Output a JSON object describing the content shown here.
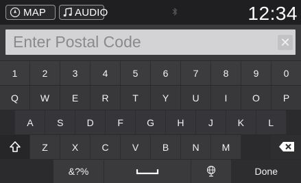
{
  "statusbar": {
    "map_label": "MAP",
    "audio_label": "AUDIO",
    "clock": "12:34",
    "icons": {
      "map": "compass-icon",
      "audio": "music-note-icon",
      "bluetooth": "bluetooth-icon"
    }
  },
  "input": {
    "placeholder": "Enter Postal Code",
    "value": "",
    "clear_glyph": "✕"
  },
  "keyboard": {
    "row1": [
      "1",
      "2",
      "3",
      "4",
      "5",
      "6",
      "7",
      "8",
      "9",
      "0"
    ],
    "row2": [
      "Q",
      "W",
      "E",
      "R",
      "T",
      "Y",
      "U",
      "I",
      "O",
      "P"
    ],
    "row3": [
      "A",
      "S",
      "D",
      "F",
      "G",
      "H",
      "J",
      "K",
      "L"
    ],
    "row4": [
      "Z",
      "X",
      "C",
      "V",
      "B",
      "N",
      "M"
    ],
    "symbols_label": "&?%",
    "done_label": "Done",
    "icons": {
      "shift": "shift-icon",
      "backspace": "backspace-icon",
      "space": "space-bar-icon",
      "globe": "globe-icon"
    }
  }
}
